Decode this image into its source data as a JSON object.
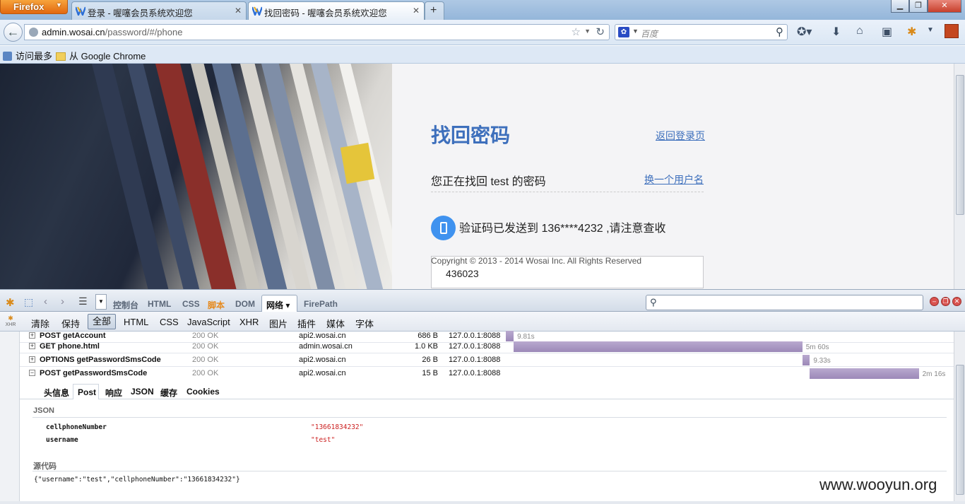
{
  "browser": {
    "app_button": "Firefox",
    "tabs": [
      {
        "title": "登录 - 喔噻会员系统欢迎您"
      },
      {
        "title": "找回密码 - 喔噻会员系统欢迎您"
      }
    ],
    "new_tab": "+",
    "url_domain": "admin.wosai.cn",
    "url_path": "/password/#/phone",
    "search_placeholder": "百度",
    "bookmarks": [
      "访问最多",
      "从 Google Chrome"
    ]
  },
  "page": {
    "title": "找回密码",
    "back_to_login": "返回登录页",
    "finding_for": "您正在找回 test 的密码",
    "change_user": "换一个用户名",
    "sent_message": "验证码已发送到 136****4232 ,请注意查收",
    "copyright": "Copyright © 2013 - 2014 Wosai Inc. All Rights Reserved",
    "code_value": "436023"
  },
  "firebug": {
    "toolbar_tabs": [
      "控制台",
      "HTML",
      "CSS",
      "脚本",
      "DOM",
      "网络",
      "FirePath"
    ],
    "active_tab": "网络",
    "filter_buttons": [
      "清除",
      "保持",
      "全部",
      "HTML",
      "CSS",
      "JavaScript",
      "XHR",
      "图片",
      "插件",
      "媒体",
      "字体"
    ],
    "xhr_label": "XHR",
    "requests": [
      {
        "method_url": "POST getAccount",
        "status": "200 OK",
        "domain": "api2.wosai.cn",
        "size": "686 B",
        "remote": "127.0.0.1:8088",
        "time": "9.81s",
        "bar_start_s": 0.0,
        "bar_duration_s": 9.81
      },
      {
        "method_url": "GET phone.html",
        "status": "200 OK",
        "domain": "admin.wosai.cn",
        "size": "1.0 KB",
        "remote": "127.0.0.1:8088",
        "time": "5m 60s",
        "bar_start_s": 9.81,
        "bar_duration_s": 360
      },
      {
        "method_url": "OPTIONS getPasswordSmsCode",
        "status": "200 OK",
        "domain": "api2.wosai.cn",
        "size": "26 B",
        "remote": "127.0.0.1:8088",
        "time": "9.33s",
        "bar_start_s": 369.8,
        "bar_duration_s": 9.33
      },
      {
        "method_url": "POST getPasswordSmsCode",
        "status": "200 OK",
        "domain": "api2.wosai.cn",
        "size": "15 B",
        "remote": "127.0.0.1:8088",
        "time": "2m 16s",
        "bar_start_s": 379.1,
        "bar_duration_s": 136
      }
    ],
    "detail_tabs": [
      "头信息",
      "Post",
      "响应",
      "JSON",
      "缓存",
      "Cookies"
    ],
    "active_detail_tab": "Post",
    "json_section": "JSON",
    "params": [
      {
        "key": "cellphoneNumber",
        "value": "\"13661834232\""
      },
      {
        "key": "username",
        "value": "\"test\""
      }
    ],
    "source_section": "源代码",
    "source_text": "{\"username\":\"test\",\"cellphoneNumber\":\"13661834232\"}"
  },
  "watermark": "www.wooyun.org",
  "colors": {
    "link": "#3d6fbc",
    "firefox_orange": "#e2680f",
    "timeline_bar": "#9c89b8",
    "json_value": "#cc2222"
  }
}
